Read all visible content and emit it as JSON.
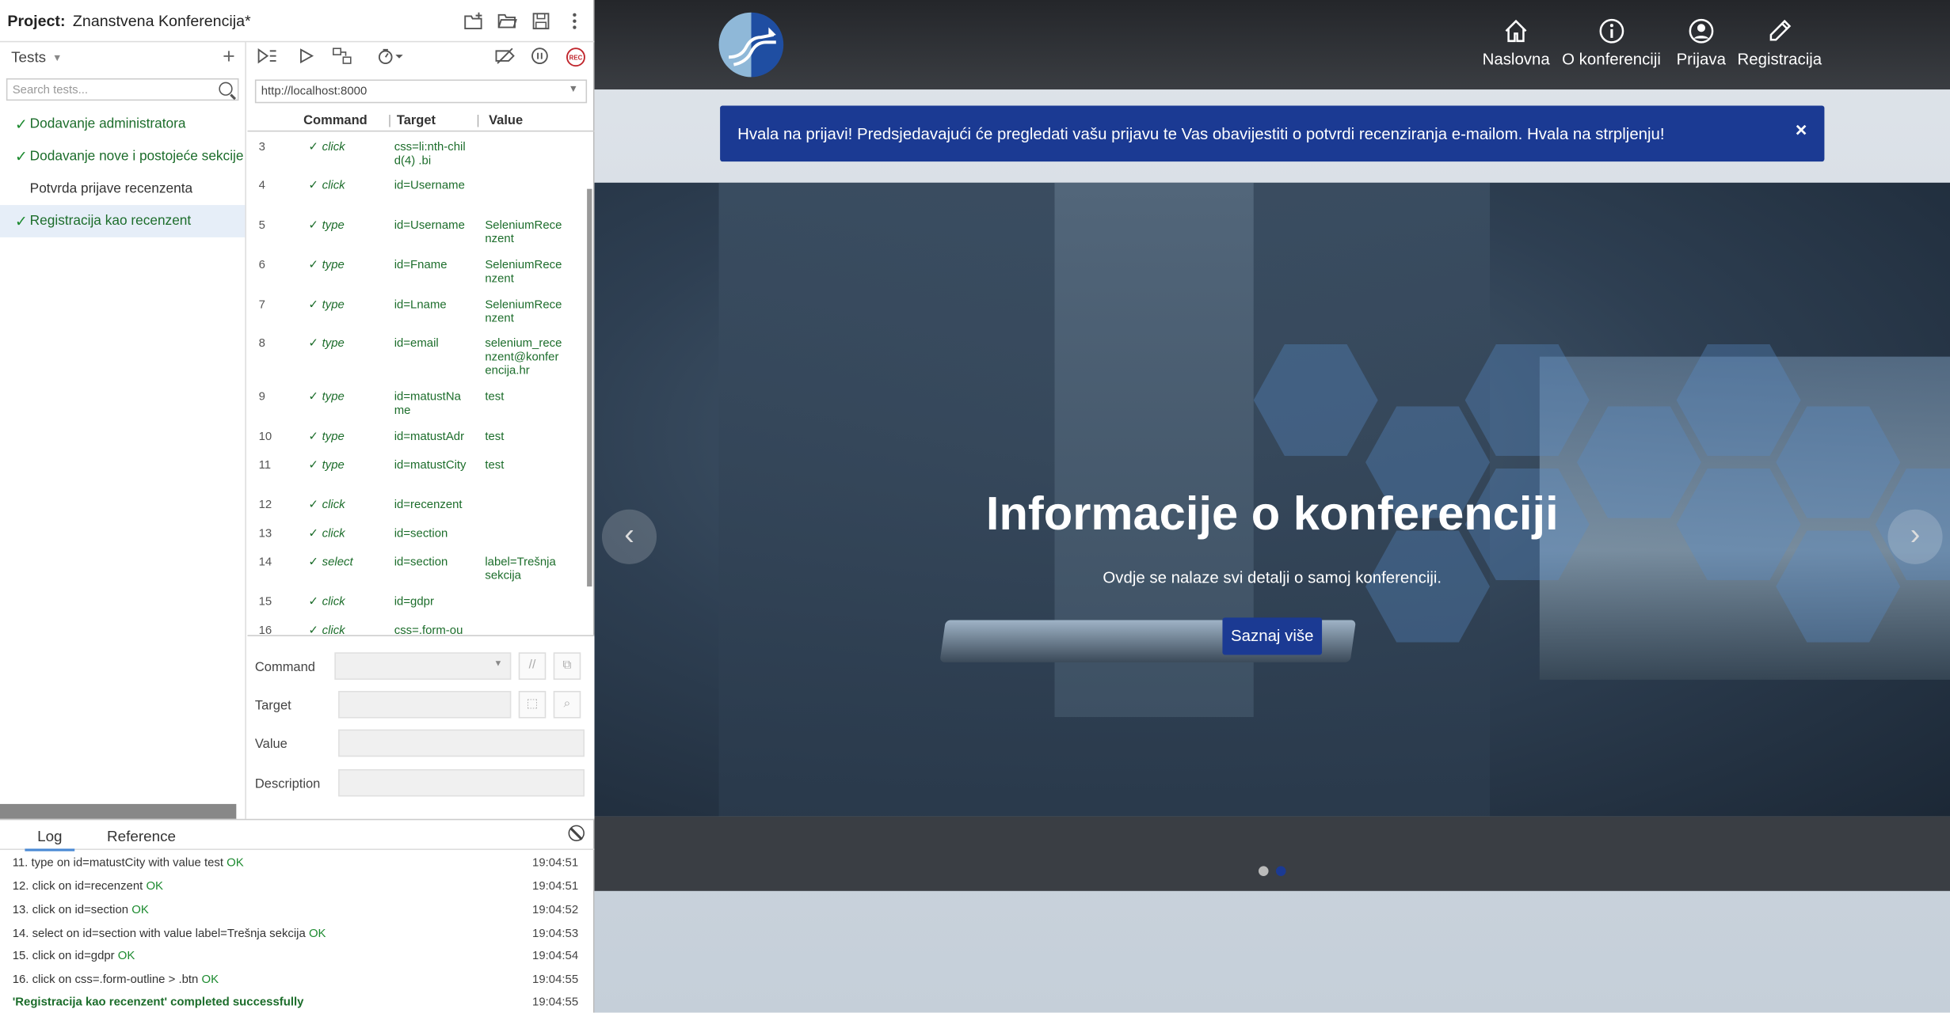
{
  "ide": {
    "project_label": "Project:",
    "project_name": "Znanstvena Konferencija*",
    "tests_header": "Tests",
    "search_placeholder": "Search tests...",
    "tests": [
      {
        "label": "Dodavanje administratora",
        "status": "passed"
      },
      {
        "label": "Dodavanje nove i postojeće sekcije",
        "status": "passed"
      },
      {
        "label": "Potvrda prijave recenzenta",
        "status": "none"
      },
      {
        "label": "Registracija kao recenzent",
        "status": "passed",
        "selected": true
      }
    ],
    "base_url": "http://localhost:8000",
    "columns": {
      "command": "Command",
      "target": "Target",
      "value": "Value"
    },
    "commands": [
      {
        "num": "3",
        "command": "click",
        "target": "css=li:nth-child(4) .bi",
        "value": ""
      },
      {
        "num": "4",
        "command": "click",
        "target": "id=Username",
        "value": ""
      },
      {
        "num": "5",
        "command": "type",
        "target": "id=Username",
        "value": "SeleniumRecenzent"
      },
      {
        "num": "6",
        "command": "type",
        "target": "id=Fname",
        "value": "SeleniumRecenzent"
      },
      {
        "num": "7",
        "command": "type",
        "target": "id=Lname",
        "value": "SeleniumRecenzent"
      },
      {
        "num": "8",
        "command": "type",
        "target": "id=email",
        "value": "selenium_recenzent@konferencija.hr"
      },
      {
        "num": "9",
        "command": "type",
        "target": "id=matustName",
        "value": "test"
      },
      {
        "num": "10",
        "command": "type",
        "target": "id=matustAdr",
        "value": "test"
      },
      {
        "num": "11",
        "command": "type",
        "target": "id=matustCity",
        "value": "test"
      },
      {
        "num": "12",
        "command": "click",
        "target": "id=recenzent",
        "value": ""
      },
      {
        "num": "13",
        "command": "click",
        "target": "id=section",
        "value": ""
      },
      {
        "num": "14",
        "command": "select",
        "target": "id=section",
        "value": "label=Trešnja sekcija"
      },
      {
        "num": "15",
        "command": "click",
        "target": "id=gdpr",
        "value": ""
      },
      {
        "num": "16",
        "command": "click",
        "target": "css=.form-ou",
        "value": ""
      }
    ],
    "editor": {
      "command": "Command",
      "target": "Target",
      "value": "Value",
      "description": "Description"
    },
    "log_tabs": {
      "log": "Log",
      "reference": "Reference"
    },
    "log": [
      {
        "text": "11. type on id=matustCity with value test",
        "status": "OK",
        "time": "19:04:51"
      },
      {
        "text": "12. click on id=recenzent",
        "status": "OK",
        "time": "19:04:51"
      },
      {
        "text": "13. click on id=section",
        "status": "OK",
        "time": "19:04:52"
      },
      {
        "text": "14. select on id=section with value label=Trešnja sekcija",
        "status": "OK",
        "time": "19:04:53"
      },
      {
        "text": "15. click on id=gdpr",
        "status": "OK",
        "time": "19:04:54"
      },
      {
        "text": "16. click on css=.form-outline > .btn",
        "status": "OK",
        "time": "19:04:55"
      },
      {
        "text": "'Registracija kao recenzent' completed successfully",
        "status": "",
        "time": "19:04:55"
      }
    ]
  },
  "site": {
    "nav": [
      {
        "label": "Naslovna",
        "icon": "home-icon"
      },
      {
        "label": "O konferenciji",
        "icon": "info-icon"
      },
      {
        "label": "Prijava",
        "icon": "user-icon"
      },
      {
        "label": "Registracija",
        "icon": "pencil-icon"
      }
    ],
    "alert": "Hvala na prijavi! Predsjedavajući će pregledati vašu prijavu te Vas obavijestiti o potvrdi recenziranja e-mailom. Hvala na strpljenju!",
    "alert_close": "×",
    "hero_title": "Informacije o konferenciji",
    "hero_subtitle": "Ovdje se nalaze svi detalji o samoj konferenciji.",
    "hero_button": "Saznaj više",
    "prev": "‹",
    "next": "›",
    "accent": "#1b3a93"
  }
}
